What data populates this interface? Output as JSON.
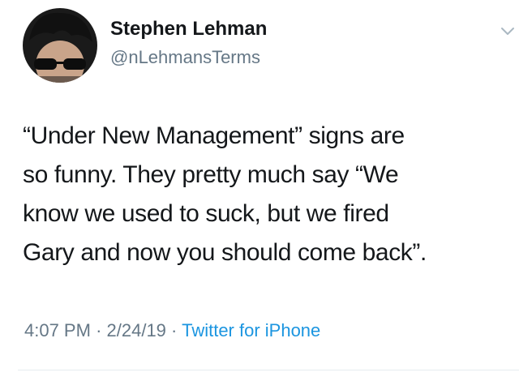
{
  "tweet": {
    "author": {
      "display_name": "Stephen Lehman",
      "handle": "@nLehmansTerms",
      "avatar_icon": "profile-photo"
    },
    "text": "“Under New Management” signs are\nso funny. They pretty much say “We\nknow we used to suck, but we fired\nGary and now you should come back”.",
    "meta": {
      "time": "4:07 PM",
      "separator": "·",
      "date": "2/24/19",
      "source": "Twitter for iPhone"
    },
    "menu_icon": "chevron-down-icon"
  },
  "colors": {
    "text": "#14171a",
    "secondary": "#657786",
    "link": "#1b95e0",
    "divider": "#e6ecf0"
  }
}
